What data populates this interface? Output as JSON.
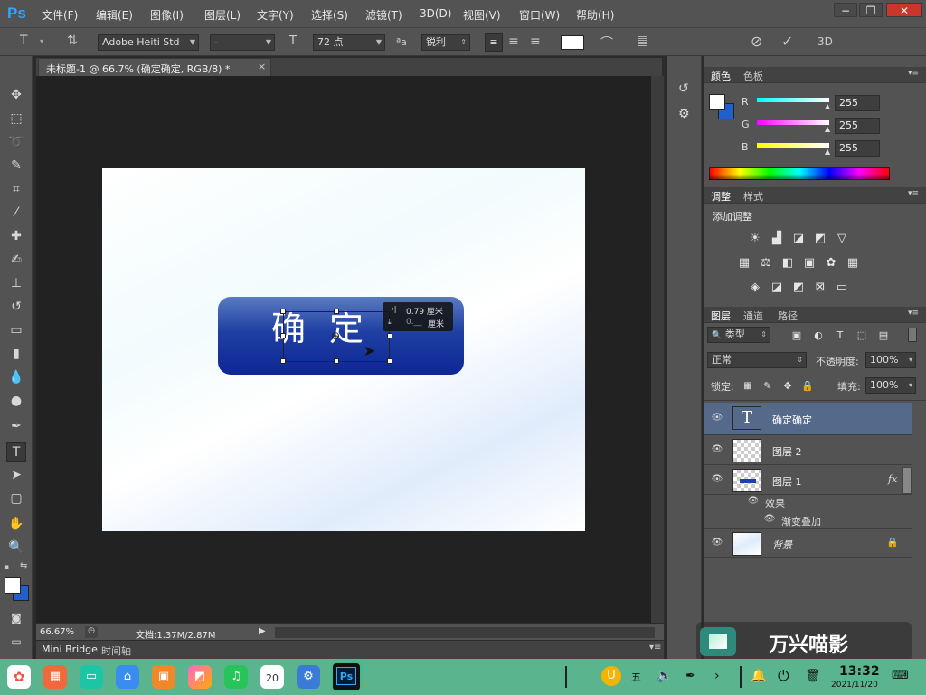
{
  "app": {
    "logo": "Ps"
  },
  "menu": [
    "文件(F)",
    "编辑(E)",
    "图像(I)",
    "图层(L)",
    "文字(Y)",
    "选择(S)",
    "滤镜(T)",
    "3D(D)",
    "视图(V)",
    "窗口(W)",
    "帮助(H)"
  ],
  "options": {
    "font_family": "Adobe Heiti Std",
    "font_style": "-",
    "font_size": "72 点",
    "aa_label": "ªa",
    "antialias": "锐利",
    "mode_3d": "3D"
  },
  "document": {
    "tab_title": "未标题-1 @ 66.7% (确定确定, RGB/8) *",
    "button_text": "确定",
    "tooltip_line1": "0.79  厘米",
    "tooltip_line2": "厘米",
    "tooltip_dim2_value": "0.__",
    "zoom": "66.67%",
    "doc_info": "文档:1.37M/2.87M"
  },
  "bottom_tabs": [
    "Mini Bridge",
    "时间轴"
  ],
  "color_panel": {
    "tabs": [
      "颜色",
      "色板"
    ],
    "channels": [
      {
        "label": "R",
        "value": "255",
        "gradient": "linear-gradient(90deg,#00ffff,#ffffff)"
      },
      {
        "label": "G",
        "value": "255",
        "gradient": "linear-gradient(90deg,#ff00ff,#ffffff)"
      },
      {
        "label": "B",
        "value": "255",
        "gradient": "linear-gradient(90deg,#ffff00,#ffffff)"
      }
    ]
  },
  "adjust_panel": {
    "tabs": [
      "调整",
      "样式"
    ],
    "heading": "添加调整"
  },
  "layers_panel": {
    "tabs": [
      "图层",
      "通道",
      "路径"
    ],
    "filter_kind": "类型",
    "blend_mode": "正常",
    "opacity_label": "不透明度:",
    "opacity": "100%",
    "lock_label": "锁定:",
    "fill_label": "填充:",
    "fill": "100%",
    "layers": [
      {
        "name": "确定确定",
        "kind": "text",
        "selected": true
      },
      {
        "name": "图层 2",
        "kind": "empty"
      },
      {
        "name": "图层 1",
        "kind": "button",
        "fx": "fx"
      },
      {
        "name": "背景",
        "kind": "background",
        "locked": true
      }
    ],
    "effects_label": "效果",
    "effect_item": "渐变叠加"
  },
  "watermark": "万兴喵影",
  "taskbar": {
    "calendar_day": "20",
    "ime": "五",
    "time": "13:32",
    "date": "2021/11/20"
  },
  "colors": {
    "foreground": "#ffffff",
    "background": "#1f5fd0",
    "selected_layer": "#55698a",
    "taskbar": "#5ab58e"
  }
}
